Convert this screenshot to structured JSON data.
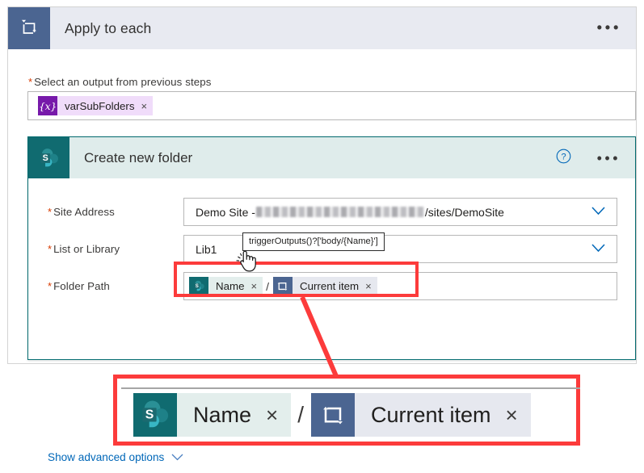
{
  "apply_card": {
    "icon": "loop-icon",
    "title": "Apply to each",
    "menu": "•••"
  },
  "output_field": {
    "required_marker": "*",
    "label": "Select an output from previous steps",
    "token": {
      "icon": "variable-icon",
      "glyph": "{x}",
      "label": "varSubFolders",
      "remove": "×"
    }
  },
  "sharepoint_card": {
    "icon": "sharepoint-icon",
    "title": "Create new folder",
    "help": "?",
    "menu": "•••",
    "rows": [
      {
        "required_marker": "*",
        "label": "Site Address",
        "value_prefix": "Demo Site - ",
        "value_suffix": "/sites/DemoSite",
        "redacted": true,
        "chevron": "chevron-down-icon"
      },
      {
        "required_marker": "*",
        "label": "List or Library",
        "value": "Lib1",
        "chevron": "chevron-down-icon"
      },
      {
        "required_marker": "*",
        "label": "Folder Path",
        "chevron": null
      }
    ],
    "folder_path_tokens": [
      {
        "icon": "sharepoint-icon",
        "label": "Name",
        "remove": "×"
      },
      {
        "separator": "/"
      },
      {
        "icon": "loop-icon",
        "label": "Current item",
        "remove": "×"
      }
    ],
    "advanced_link": {
      "label": "Show advanced options",
      "chevron": "chevron-down-icon"
    }
  },
  "tooltip": {
    "text": "triggerOutputs()?['body/{Name}']"
  },
  "cursor": {
    "icon": "hand-pointer-cursor"
  },
  "callout": {
    "tokens": [
      {
        "icon": "sharepoint-icon",
        "label": "Name",
        "remove": "×"
      },
      {
        "separator": "/"
      },
      {
        "icon": "loop-icon",
        "label": "Current item",
        "remove": "×"
      }
    ]
  },
  "colors": {
    "loop_blue": "#4b6591",
    "sharepoint_teal": "#106b70",
    "variable_purple": "#7719aa",
    "highlight_red": "#fc3b3b",
    "link_blue": "#0067b8",
    "required_red": "#d83b01",
    "card_header_grey": "#e8eaf1",
    "sp_header_green": "#dfeceb"
  }
}
